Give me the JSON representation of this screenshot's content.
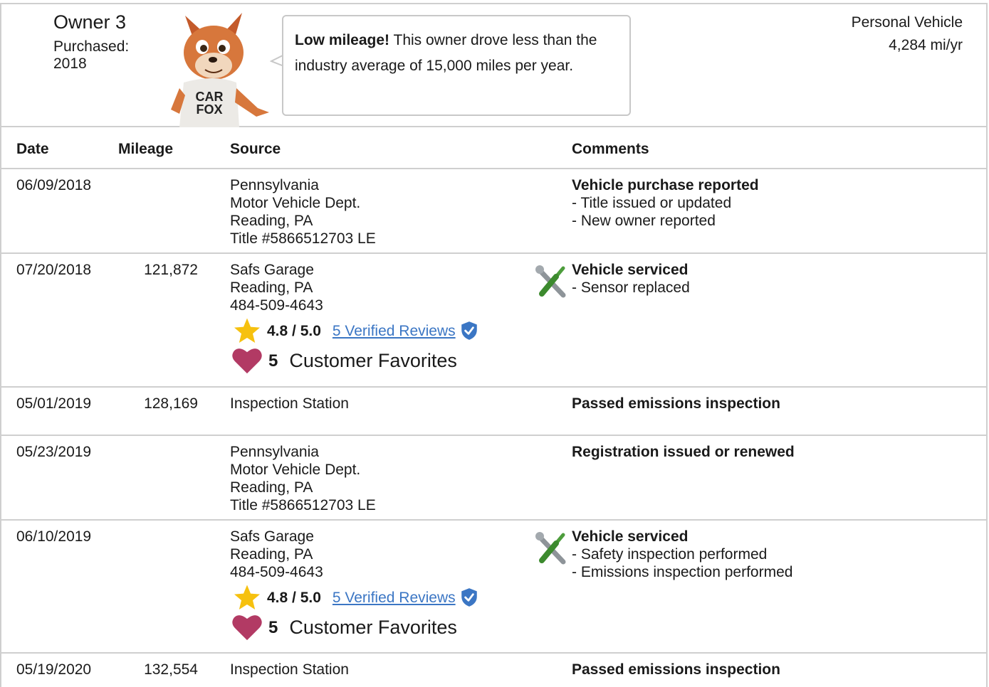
{
  "owner": {
    "title": "Owner 3",
    "purchased_label": "Purchased:",
    "purchased_year": "2018",
    "vehicle_type": "Personal Vehicle",
    "miles_per_year": "4,284 mi/yr",
    "bubble_bold": "Low mileage!",
    "bubble_text": " This owner drove less than the industry average of 15,000 miles per year."
  },
  "columns": {
    "date": "Date",
    "mileage": "Mileage",
    "source": "Source",
    "comments": "Comments"
  },
  "rows": [
    {
      "date": "06/09/2018",
      "mileage": "",
      "source": [
        "Pennsylvania",
        "Motor Vehicle Dept.",
        "Reading, PA",
        "Title #5866512703 LE"
      ],
      "comment_title": "Vehicle purchase reported",
      "comment_lines": [
        "- Title issued or updated",
        "- New owner reported"
      ]
    },
    {
      "date": "07/20/2018",
      "mileage": "121,872",
      "source": [
        "Safs Garage",
        "Reading, PA",
        "484-509-4643"
      ],
      "rating": "4.8 / 5.0",
      "reviews": "5 Verified Reviews",
      "fav_count": "5",
      "fav_label": "Customer Favorites",
      "icon": "wrench-screwdriver-icon",
      "comment_title": "Vehicle serviced",
      "comment_lines": [
        "- Sensor replaced"
      ]
    },
    {
      "date": "05/01/2019",
      "mileage": "128,169",
      "source": [
        "Inspection Station"
      ],
      "comment_title": "Passed emissions inspection",
      "comment_lines": []
    },
    {
      "date": "05/23/2019",
      "mileage": "",
      "source": [
        "Pennsylvania",
        "Motor Vehicle Dept.",
        "Reading, PA",
        "Title #5866512703 LE"
      ],
      "comment_title": "Registration issued or renewed",
      "comment_lines": []
    },
    {
      "date": "06/10/2019",
      "mileage": "",
      "source": [
        "Safs Garage",
        "Reading, PA",
        "484-509-4643"
      ],
      "rating": "4.8 / 5.0",
      "reviews": "5 Verified Reviews",
      "fav_count": "5",
      "fav_label": "Customer Favorites",
      "icon": "wrench-screwdriver-icon",
      "comment_title": "Vehicle serviced",
      "comment_lines": [
        "- Safety inspection performed",
        "- Emissions inspection performed"
      ]
    },
    {
      "date": "05/19/2020",
      "mileage": "132,554",
      "source": [
        "Inspection Station"
      ],
      "comment_title": "Passed emissions inspection",
      "comment_lines": []
    }
  ],
  "colors": {
    "link": "#3b76c4",
    "star": "#f6c10f",
    "heart": "#b23a64",
    "border": "#cfcfcf"
  }
}
